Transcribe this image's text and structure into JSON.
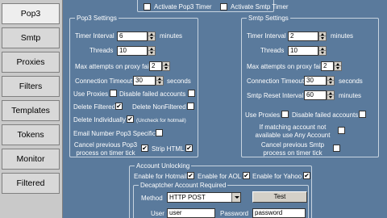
{
  "tabs": [
    "Pop3",
    "Smtp",
    "Proxies",
    "Filters",
    "Templates",
    "Tokens",
    "Monitor",
    "Filtered"
  ],
  "top": {
    "activate_pop3_timer": "Activate Pop3 Timer",
    "activate_smtp_timer": "Activate Smtp Timer"
  },
  "pop3": {
    "title": "Pop3 Settings",
    "timer_interval_label": "Timer Interval",
    "timer_interval_value": "6",
    "timer_interval_unit": "minutes",
    "threads_label": "Threads",
    "threads_value": "10",
    "max_attempts_label": "Max attempts on proxy fail",
    "max_attempts_value": "2",
    "connection_timeout_label": "Connection Timeout",
    "connection_timeout_value": "30",
    "connection_timeout_unit": "seconds",
    "use_proxies_label": "Use Proxies",
    "disable_failed_label": "Disable failed accounts",
    "delete_filtered_label": "Delete Filtered",
    "delete_filtered_checked": true,
    "delete_nonfiltered_label": "Delete NonFiltered",
    "delete_individually_label": "Delete Individually",
    "delete_individually_note": "(Uncheck for hotmail)",
    "delete_individually_checked": true,
    "email_number_label": "Email Number Pop3 Specific",
    "cancel_previous_label": "Cancel previous Pop3 process on timer tick",
    "cancel_previous_checked": true,
    "strip_html_label": "Strip HTML",
    "strip_html_checked": true
  },
  "smtp": {
    "title": "Smtp Settings",
    "timer_interval_label": "Timer Interval",
    "timer_interval_value": "2",
    "timer_interval_unit": "minutes",
    "threads_label": "Threads",
    "threads_value": "10",
    "max_attempts_label": "Max attempts on proxy fail",
    "max_attempts_value": "2",
    "connection_timeout_label": "Connection Timeout",
    "connection_timeout_value": "30",
    "connection_timeout_unit": "seconds",
    "reset_interval_label": "Smtp Reset Interval",
    "reset_interval_value": "60",
    "reset_interval_unit": "minutes",
    "use_proxies_label": "Use Proxies",
    "disable_failed_label": "Disable failed accounts",
    "if_matching_label": "If matching account not available use Any Account",
    "cancel_previous_label": "Cancel previous Smtp process on timer tick"
  },
  "unlocking": {
    "title": "Account Unlocking",
    "hotmail_label": "Enable for Hotmail",
    "hotmail_checked": true,
    "aol_label": "Enable for AOL",
    "aol_checked": true,
    "yahoo_label": "Enable for Yahoo",
    "yahoo_checked": true
  },
  "decaptcher": {
    "title": "Decaptcher Account Required",
    "method_label": "Method",
    "method_value": "HTTP POST",
    "test_label": "Test",
    "user_label": "User",
    "user_value": "user",
    "password_label": "Password",
    "password_value": "password"
  },
  "check_mark": "✔",
  "colors": {
    "panel": "#5a7a9c",
    "tab_bg": "#d8d8d8",
    "border": "#c8d4e0"
  }
}
